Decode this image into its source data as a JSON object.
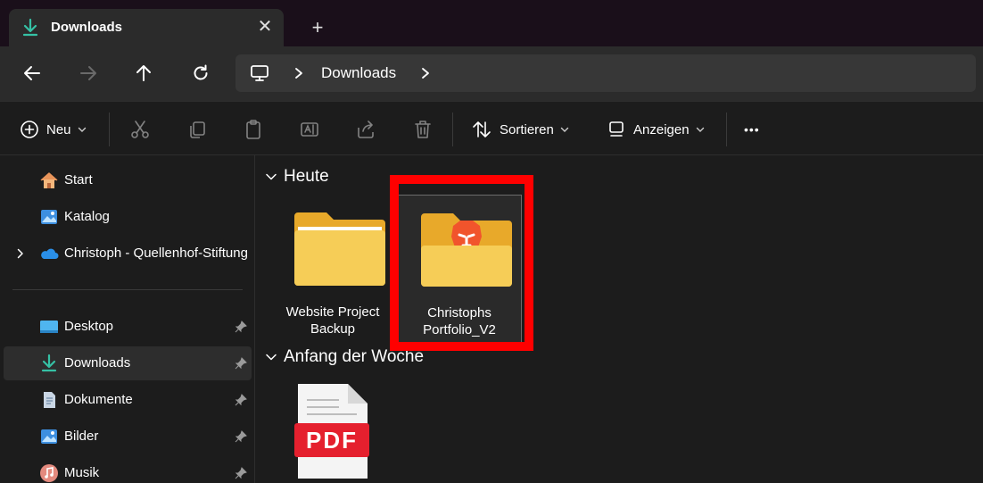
{
  "tab": {
    "title": "Downloads",
    "icon": "download-icon",
    "close_glyph": "✕",
    "new_glyph": "+"
  },
  "nav": {
    "back_icon": "arrow-left-icon",
    "forward_icon": "arrow-right-icon",
    "up_icon": "arrow-up-icon",
    "refresh_icon": "refresh-icon",
    "address": {
      "computer_icon": "computer-icon",
      "segment": "Downloads"
    }
  },
  "toolbar": {
    "new_label": "Neu",
    "sort_label": "Sortieren",
    "view_label": "Anzeigen",
    "more_glyph": "•••"
  },
  "sidebar": {
    "items": [
      {
        "label": "Start",
        "icon": "home-icon"
      },
      {
        "label": "Katalog",
        "icon": "gallery-icon"
      },
      {
        "label": "Christoph - Quellenhof-Stiftung",
        "icon": "cloud-icon"
      },
      {
        "label": "Desktop",
        "icon": "desktop-icon"
      },
      {
        "label": "Downloads",
        "icon": "download-icon",
        "active": true
      },
      {
        "label": "Dokumente",
        "icon": "document-icon"
      },
      {
        "label": "Bilder",
        "icon": "pictures-icon"
      },
      {
        "label": "Musik",
        "icon": "music-icon"
      }
    ]
  },
  "content": {
    "groups": [
      {
        "label": "Heute",
        "files": [
          {
            "name": "Website Project Backup",
            "icon": "folder-icon"
          },
          {
            "name": "Christophs Portfolio_V2",
            "icon": "brave-folder-icon"
          }
        ]
      },
      {
        "label": "Anfang der Woche",
        "files": [
          {
            "name": "",
            "icon": "pdf-file-icon",
            "badge": "PDF"
          }
        ]
      }
    ]
  },
  "colors": {
    "accent_teal": "#35c1a5",
    "highlight_red": "#ff0000",
    "folder_yellow": "#f6c94b",
    "brave_orange": "#f1542c",
    "pdf_red": "#e5202e"
  }
}
